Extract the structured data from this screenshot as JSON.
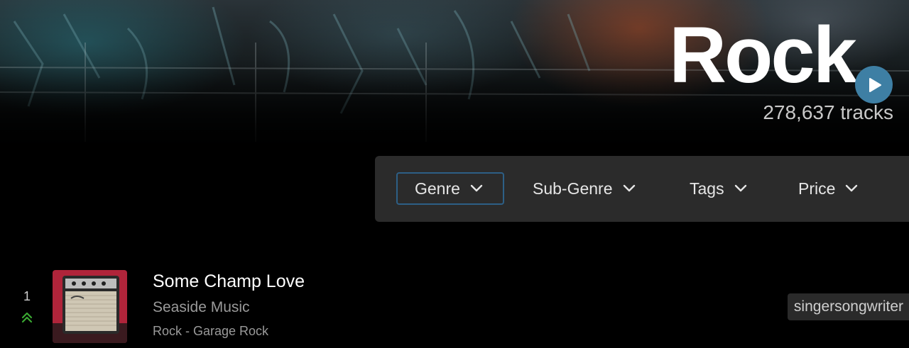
{
  "hero": {
    "genre_title": "Rock",
    "track_count": "278,637 tracks",
    "play_icon": "play-icon"
  },
  "filters": [
    {
      "label": "Genre",
      "icon": "chevron-down-icon",
      "active": true
    },
    {
      "label": "Sub-Genre",
      "icon": "chevron-down-icon",
      "active": false
    },
    {
      "label": "Tags",
      "icon": "chevron-down-icon",
      "active": false
    },
    {
      "label": "Price",
      "icon": "chevron-down-icon",
      "active": false
    }
  ],
  "tracks": [
    {
      "rank": "1",
      "trend_icon": "double-chevron-up-icon",
      "title": "Some Champ Love",
      "label": "Seaside Music",
      "genres": "Rock - Garage Rock",
      "tag": "singersongwriter"
    }
  ],
  "colors": {
    "accent": "#3e7fa4",
    "trend_up": "#3aa832",
    "filter_active_border": "#2d5f86",
    "filter_bar_bg": "#2b2b2b"
  }
}
